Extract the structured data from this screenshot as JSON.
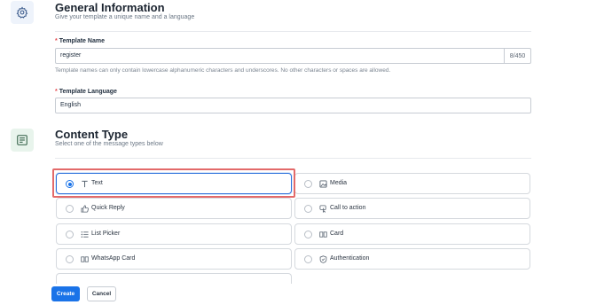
{
  "general": {
    "title": "General Information",
    "subtitle": "Give your template a unique name and a language"
  },
  "template_name": {
    "label": "Template Name",
    "required_mark": "*",
    "value": "register",
    "counter": "8/450",
    "hint": "Template names can only contain lowercase alphanumeric characters and underscores. No other characters or spaces are allowed."
  },
  "template_language": {
    "label": "Template Language",
    "required_mark": "*",
    "value": "English"
  },
  "content": {
    "title": "Content Type",
    "subtitle": "Select one of the message types below",
    "selected": "Text",
    "options": [
      {
        "label": "Text",
        "icon": "text-icon"
      },
      {
        "label": "Media",
        "icon": "image-icon"
      },
      {
        "label": "Quick Reply",
        "icon": "thumbs-up-icon"
      },
      {
        "label": "Call to action",
        "icon": "pointer-icon"
      },
      {
        "label": "List Picker",
        "icon": "list-icon"
      },
      {
        "label": "Card",
        "icon": "card-icon"
      },
      {
        "label": "WhatsApp Card",
        "icon": "card-icon"
      },
      {
        "label": "Authentication",
        "icon": "shield-icon"
      }
    ]
  },
  "actions": {
    "create_label": "Create",
    "cancel_label": "Cancel"
  },
  "colors": {
    "primary": "#1a73e8",
    "highlight": "#e36a6a"
  }
}
